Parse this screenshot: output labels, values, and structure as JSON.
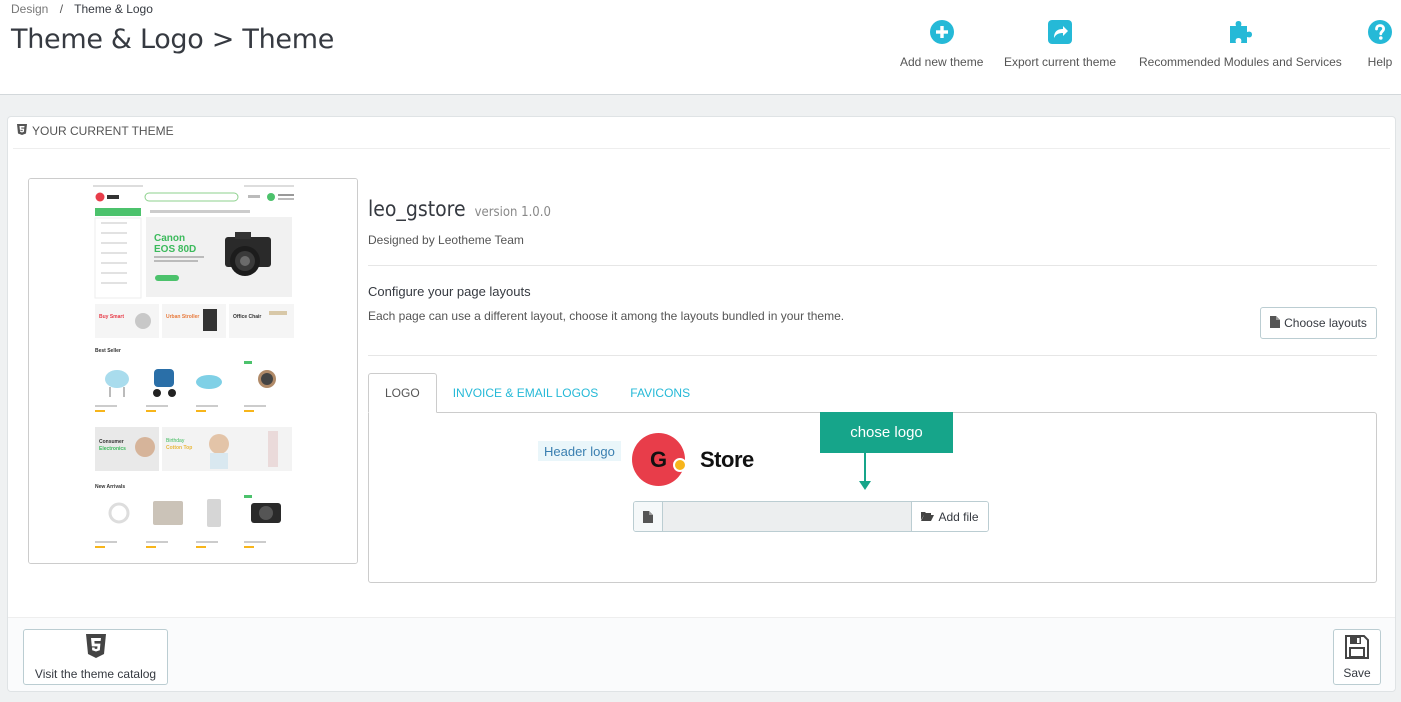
{
  "breadcrumb": {
    "parent": "Design",
    "separator": "/",
    "current": "Theme & Logo"
  },
  "page_title": "Theme & Logo > Theme",
  "toolbar": {
    "add_theme": "Add new theme",
    "export_theme": "Export current theme",
    "recommended": "Recommended Modules and Services",
    "help": "Help"
  },
  "panel": {
    "heading": "YOUR CURRENT THEME"
  },
  "theme": {
    "name": "leo_gstore",
    "version": "version 1.0.0",
    "designer": "Designed by Leotheme Team"
  },
  "layouts": {
    "title": "Configure your page layouts",
    "description": "Each page can use a different layout, choose it among the layouts bundled in your theme.",
    "button": "Choose layouts"
  },
  "tabs": [
    {
      "label": "LOGO",
      "active": true
    },
    {
      "label": "INVOICE & EMAIL LOGOS",
      "active": false
    },
    {
      "label": "FAVICONS",
      "active": false
    }
  ],
  "logo_tab": {
    "header_logo_label": "Header logo",
    "logo_text": {
      "letter": "G",
      "word": "Store"
    },
    "callout": "chose logo",
    "file_value": "",
    "add_file": "Add file"
  },
  "preview": {
    "hero_line1": "Canon",
    "hero_line2": "EOS 80D",
    "banner1": "Buy Smart",
    "banner2": "Urban Stroller",
    "banner3": "Office Chair",
    "section1": "Best Seller",
    "section2": "New Arrivals",
    "promo1_line1": "Consumer",
    "promo1_line2": "Electronics",
    "promo2_line1": "Birthday",
    "promo2_line2": "Cotton Top"
  },
  "footer": {
    "catalog": "Visit the theme catalog",
    "save": "Save"
  },
  "colors": {
    "accent": "#25b9d7",
    "callout": "#16a58a",
    "brand_red": "#e83d4a"
  }
}
